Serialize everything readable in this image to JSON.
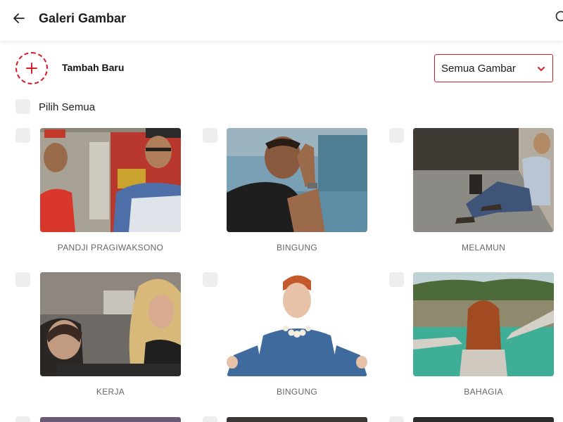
{
  "header": {
    "title": "Galeri Gambar",
    "back_icon": "arrow-left-icon",
    "search_icon": "search-icon"
  },
  "toolbar": {
    "add_label": "Tambah Baru",
    "add_icon": "plus-icon",
    "filter": {
      "selected": "Semua Gambar",
      "icon": "chevron-down-icon"
    },
    "select_all_label": "Pilih Semua"
  },
  "colors": {
    "accent": "#d71e28",
    "checkbox": "#eeeeee",
    "caption": "#666666"
  },
  "gallery": {
    "items": [
      {
        "caption": "PANDJI PRAGIWAKSONO"
      },
      {
        "caption": "BINGUNG"
      },
      {
        "caption": "MELAMUN"
      },
      {
        "caption": "KERJA"
      },
      {
        "caption": "BINGUNG"
      },
      {
        "caption": "BAHAGIA"
      }
    ]
  }
}
